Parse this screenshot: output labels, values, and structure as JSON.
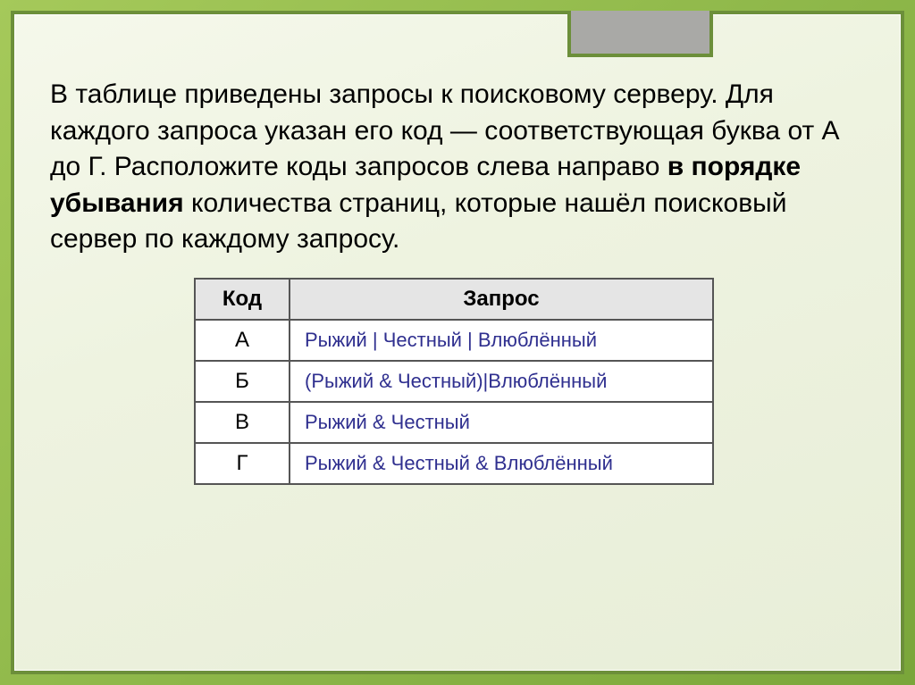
{
  "paragraph": {
    "part1": "В таблице приведены запросы к поисковому серверу. Для каждого запроса указан его код — соответствующая буква от А до Г. Расположите коды запросов слева направо ",
    "bold1": "в порядке убывания",
    "part2": " количества страниц, которые нашёл поисковый сервер по каждому запросу."
  },
  "table": {
    "headers": {
      "code": "Код",
      "query": "Запрос"
    },
    "rows": [
      {
        "code": "А",
        "query": "Рыжий | Честный | Влюблённый"
      },
      {
        "code": "Б",
        "query": "(Рыжий & Честный)|Влюблённый"
      },
      {
        "code": "В",
        "query": "Рыжий & Честный"
      },
      {
        "code": "Г",
        "query": "Рыжий & Честный & Влюблённый"
      }
    ]
  }
}
